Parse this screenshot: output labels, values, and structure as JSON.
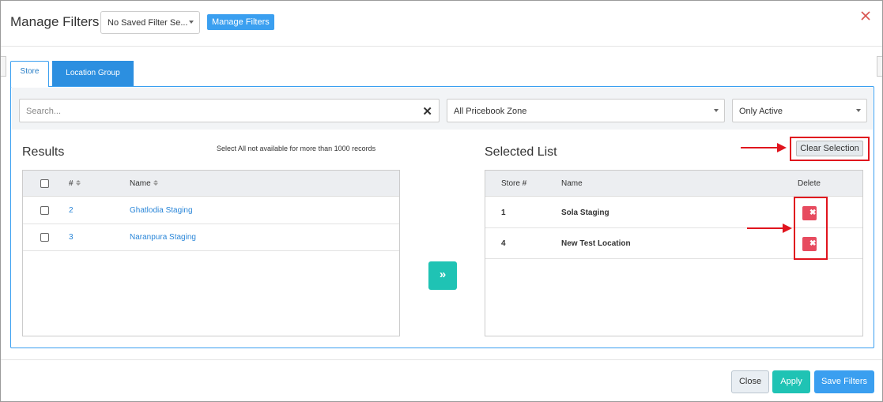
{
  "header": {
    "title": "Manage Filters",
    "saved_filter_value": "No Saved Filter Se...",
    "manage_button": "Manage Filters",
    "close_icon": "close-x-icon"
  },
  "tabs": [
    {
      "label": "Store",
      "active": true
    },
    {
      "label": "Location Group",
      "active": false
    }
  ],
  "filters": {
    "search_placeholder": "Search...",
    "pricebook_zone": "All Pricebook Zone",
    "status": "Only Active"
  },
  "results": {
    "title": "Results",
    "note": "Select All not available for more than 1000 records",
    "columns": {
      "num": "#",
      "name": "Name"
    },
    "rows": [
      {
        "num": "2",
        "name": "Ghatlodia Staging"
      },
      {
        "num": "3",
        "name": "Naranpura Staging"
      }
    ]
  },
  "move_button_icon": "double-chevron-right-icon",
  "selected": {
    "title": "Selected List",
    "clear_button": "Clear Selection",
    "columns": {
      "store": "Store #",
      "name": "Name",
      "delete": "Delete"
    },
    "rows": [
      {
        "store": "1",
        "name": "Sola Staging"
      },
      {
        "store": "4",
        "name": "New Test Location"
      }
    ]
  },
  "footer": {
    "close": "Close",
    "apply": "Apply",
    "save": "Save Filters"
  },
  "colors": {
    "primary": "#3a9ff0",
    "teal": "#1fc3b4",
    "danger": "#e74b5f",
    "annotation_red": "#e0141e"
  }
}
